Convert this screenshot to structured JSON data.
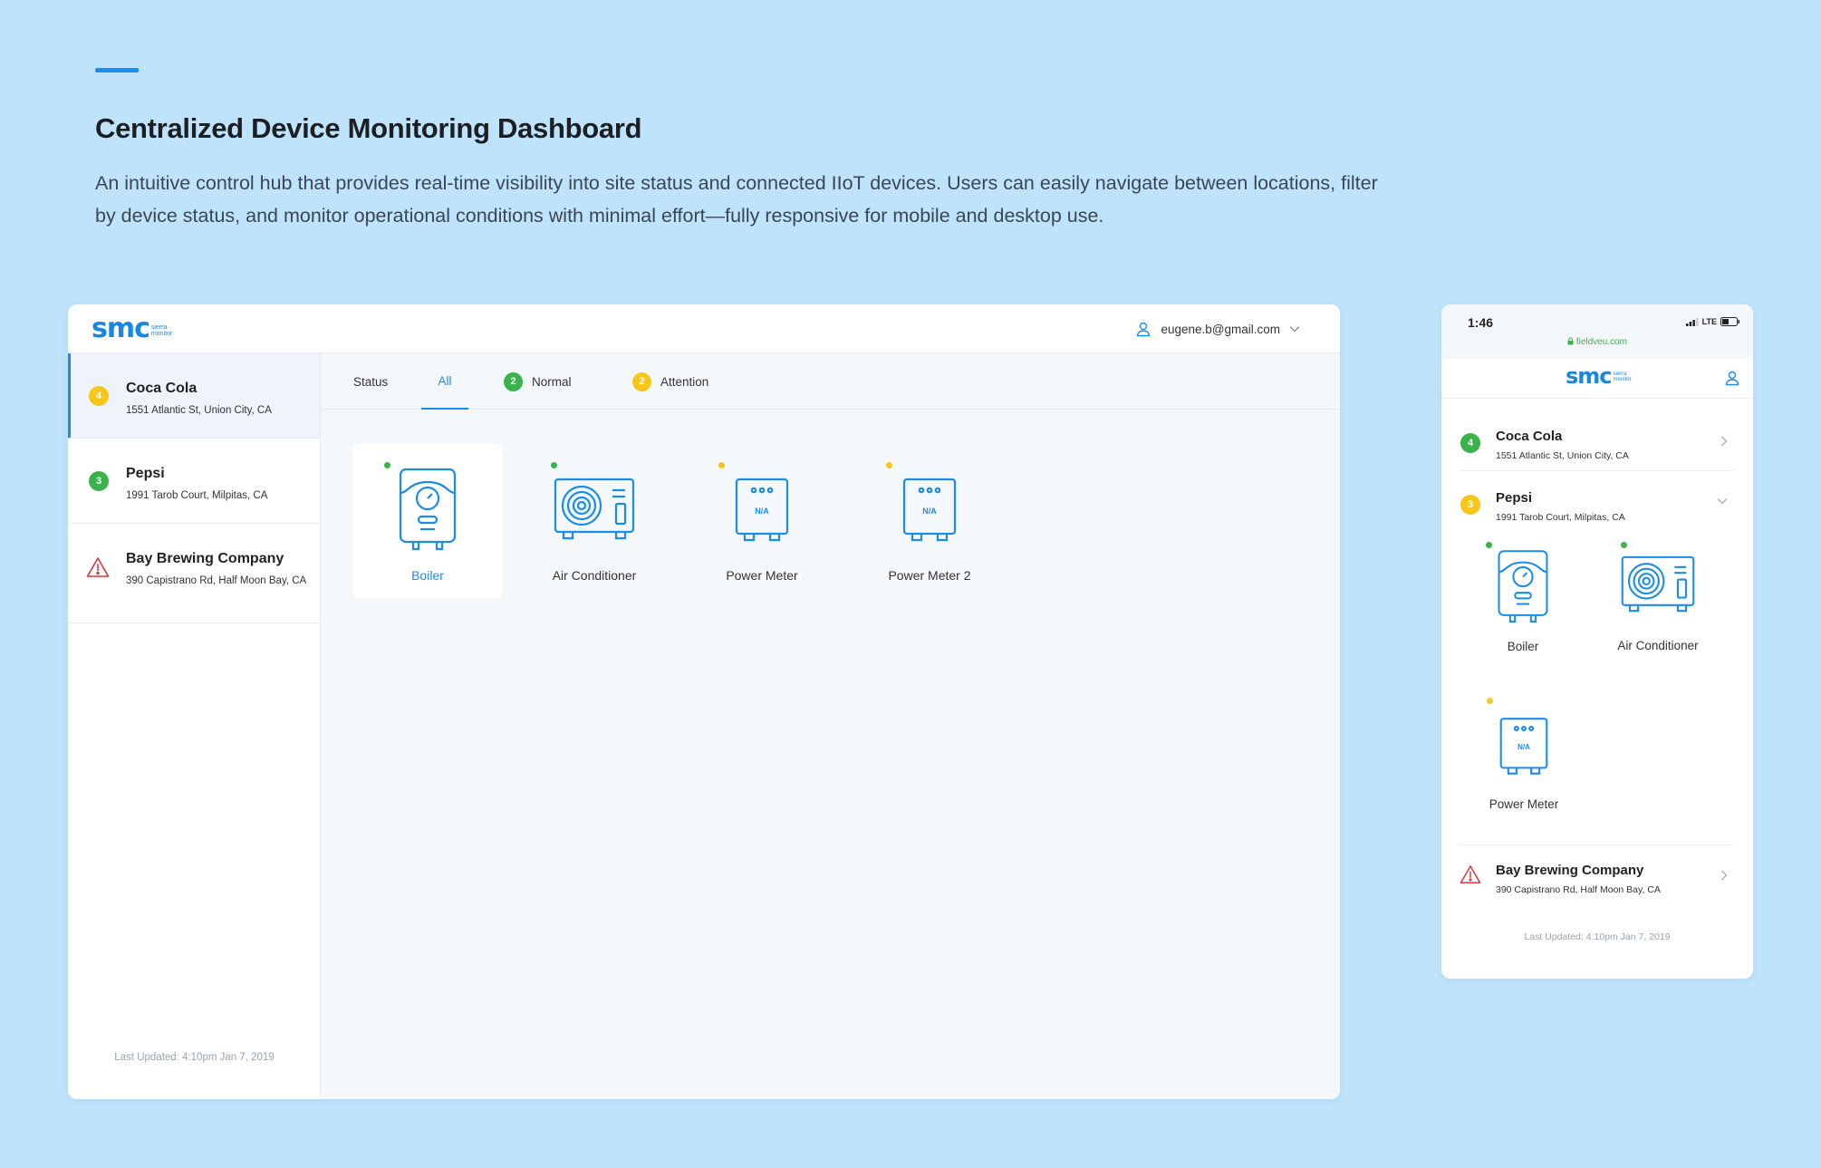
{
  "hero": {
    "title": "Centralized Device Monitoring Dashboard",
    "description": "An intuitive control hub that provides real-time visibility into site status and connected IIoT devices. Users can easily navigate between locations, filter by device status, and monitor operational conditions with minimal effort—fully responsive for mobile and desktop use."
  },
  "colors": {
    "accent": "#1a8cea",
    "normal": "#3ab34a",
    "attention": "#f6c71a",
    "alert": "#d9363e",
    "background": "#bfe3fb"
  },
  "brand": {
    "logo": "smc",
    "logo_sub": "sierra monitor"
  },
  "desktop": {
    "user_email": "eugene.b@gmail.com",
    "sites": [
      {
        "name": "Coca Cola",
        "address": "1551 Atlantic St, Union City, CA",
        "count": "4",
        "status": "attention"
      },
      {
        "name": "Pepsi",
        "address": "1991 Tarob Court, Milpitas, CA",
        "count": "3",
        "status": "normal"
      },
      {
        "name": "Bay Brewing Company",
        "address": "390 Capistrano Rd, Half Moon Bay, CA",
        "status": "alert"
      }
    ],
    "last_updated": "Last Updated: 4:10pm Jan 7, 2019",
    "tabs": {
      "label": "Status",
      "all": "All",
      "normal": "Normal",
      "normal_count": "2",
      "attention": "Attention",
      "attention_count": "2"
    },
    "devices": [
      {
        "name": "Boiler",
        "status": "normal",
        "icon": "boiler-icon"
      },
      {
        "name": "Air Conditioner",
        "status": "normal",
        "icon": "air-conditioner-icon"
      },
      {
        "name": "Power Meter",
        "status": "attention",
        "icon": "power-meter-icon",
        "display": "N/A"
      },
      {
        "name": "Power Meter 2",
        "status": "attention",
        "icon": "power-meter-icon",
        "display": "N/A"
      }
    ]
  },
  "mobile": {
    "time": "1:46",
    "network": "LTE",
    "url": "fieldveu.com",
    "sites": [
      {
        "name": "Coca Cola",
        "address": "1551 Atlantic St, Union City, CA",
        "count": "4",
        "status": "normal"
      },
      {
        "name": "Pepsi",
        "address": "1991 Tarob Court, Milpitas, CA",
        "count": "3",
        "status": "attention"
      },
      {
        "name": "Bay Brewing Company",
        "address": "390 Capistrano Rd, Half Moon Bay, CA",
        "status": "alert"
      }
    ],
    "devices": [
      {
        "name": "Boiler",
        "status": "normal"
      },
      {
        "name": "Air Conditioner",
        "status": "normal"
      },
      {
        "name": "Power Meter",
        "status": "attention",
        "display": "N/A"
      }
    ],
    "last_updated": "Last Updated: 4:10pm Jan 7, 2019"
  }
}
